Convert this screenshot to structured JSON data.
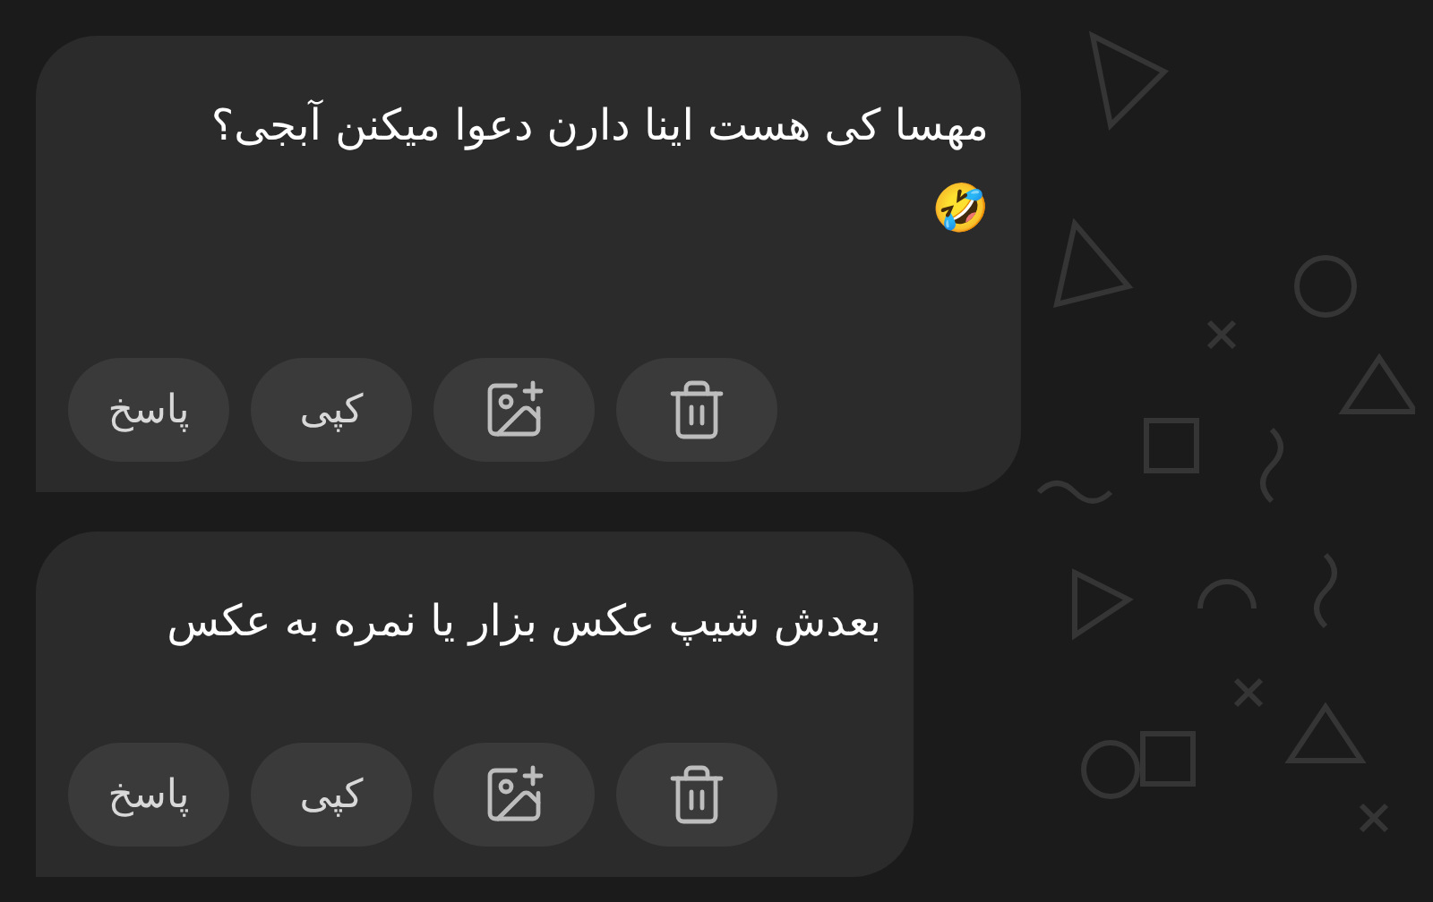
{
  "messages": [
    {
      "text": "مهسا کی هست اینا دارن دعوا میکنن آبجی؟",
      "emoji": "🤣",
      "actions": [
        {
          "kind": "delete"
        },
        {
          "kind": "image"
        },
        {
          "kind": "copy",
          "label": "کپی"
        },
        {
          "kind": "reply",
          "label": "پاسخ"
        }
      ]
    },
    {
      "text": "بعدش شیپ عکس بزار یا نمره به عکس",
      "actions": [
        {
          "kind": "delete"
        },
        {
          "kind": "image"
        },
        {
          "kind": "copy",
          "label": "کپی"
        },
        {
          "kind": "reply",
          "label": "پاسخ"
        }
      ]
    }
  ]
}
